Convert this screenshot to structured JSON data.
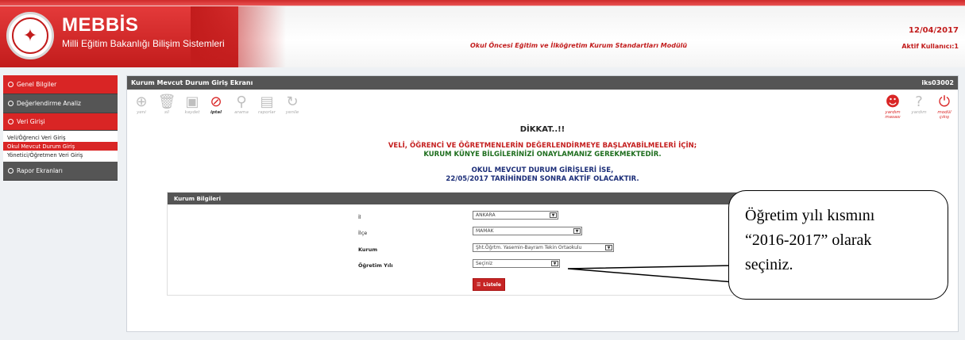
{
  "header": {
    "brand": "MEBBİS",
    "subtitle": "Milli Eğitim Bakanlığı Bilişim Sistemleri",
    "module_title": "Okul Öncesi Eğitim ve İlköğretim Kurum Standartları Modülü",
    "date": "12/04/2017",
    "user_label": "Aktif Kullanıcı:1",
    "accent_color": "#d92525"
  },
  "sidebar": {
    "items": [
      {
        "label": "Genel Bilgiler"
      },
      {
        "label": "Değerlendirme Analiz"
      },
      {
        "label": "Veri Girişi"
      },
      {
        "label": "Rapor Ekranları"
      }
    ],
    "sub_items": [
      {
        "label": "Veli/Öğrenci Veri Giriş"
      },
      {
        "label": "Okul Mevcut Durum Giriş"
      },
      {
        "label": "Yönetici/Öğretmen Veri Giriş"
      }
    ]
  },
  "panel": {
    "title": "Kurum Mevcut Durum Giriş Ekranı",
    "code": "iks03002"
  },
  "toolbar": {
    "tools": [
      {
        "label": "yeni",
        "icon": "plus-circle-icon"
      },
      {
        "label": "sil",
        "icon": "trash-icon"
      },
      {
        "label": "kaydet",
        "icon": "save-icon"
      },
      {
        "label": "iptal",
        "icon": "cancel-icon"
      },
      {
        "label": "arama",
        "icon": "search-icon"
      },
      {
        "label": "raporlar",
        "icon": "report-icon"
      },
      {
        "label": "yenile",
        "icon": "refresh-icon"
      }
    ],
    "right_tools": [
      {
        "label": "yardım masası",
        "icon": "helpdesk-icon"
      },
      {
        "label": "yardım",
        "icon": "help-icon"
      },
      {
        "label": "modül çıkış",
        "icon": "power-icon"
      }
    ]
  },
  "warning": {
    "title": "DİKKAT..!!",
    "line1": "VELİ, ÖĞRENCİ VE ÖĞRETMENLERİN DEĞERLENDİRMEYE BAŞLAYABİLMELERİ İÇİN;",
    "line2": "KURUM KÜNYE BİLGİLERİNİZİ ONAYLAMANIZ GEREKMEKTEDİR.",
    "line3": "OKUL MEVCUT DURUM GİRİŞLERİ İSE,",
    "line4": "22/05/2017 TARİHİNDEN SONRA AKTİF OLACAKTIR."
  },
  "form": {
    "section_title": "Kurum Bilgileri",
    "fields": [
      {
        "label": "İl",
        "value": "ANKARA"
      },
      {
        "label": "İlçe",
        "value": "MAMAK"
      },
      {
        "label": "Kurum",
        "value": "Şht.Öğrtm. Yasemin-Bayram Tekin Ortaokulu"
      },
      {
        "label": "Öğretim Yılı",
        "value": "Seçiniz"
      }
    ],
    "list_button": "Listele"
  },
  "callout": {
    "line1": "Öğretim yılı kısmını",
    "line2": "“2016-2017” olarak",
    "line3": "seçiniz."
  }
}
